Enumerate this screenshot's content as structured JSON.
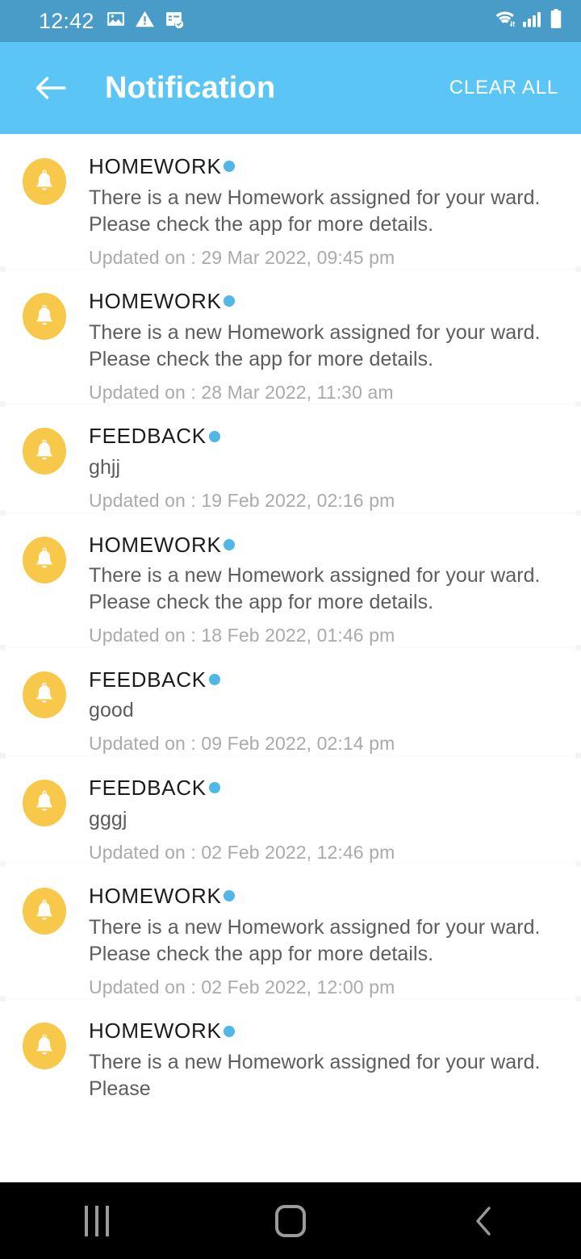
{
  "statusbar": {
    "time": "12:42",
    "left_icons": [
      "photo-icon",
      "warning-triangle-icon",
      "document-check-icon"
    ],
    "right_icons": [
      "wifi-icon",
      "cellular-signal-icon",
      "battery-icon"
    ],
    "background_color": "#4a9cc8"
  },
  "header": {
    "back_icon": "back-arrow-icon",
    "title": "Notification",
    "clear_all_label": "CLEAR ALL",
    "background_color": "#5bc6f5",
    "text_color": "#ffffff"
  },
  "theme": {
    "bell_badge_color": "#f8c84a",
    "unread_dot_color": "#4fb8e8",
    "title_color": "#1b1b1b",
    "desc_color": "#5d5d5d",
    "time_color": "#abaaaa",
    "page_background": "#ffffff",
    "navbar_background": "#000000"
  },
  "notifications": [
    {
      "icon": "bell-icon",
      "title": "HOMEWORK",
      "unread": true,
      "description": "There is a new Homework assigned for your ward. Please check the app for more details.",
      "time": "Updated on : 29 Mar 2022, 09:45 pm"
    },
    {
      "icon": "bell-icon",
      "title": "HOMEWORK",
      "unread": true,
      "description": "There is a new Homework assigned for your ward. Please check the app for more details.",
      "time": "Updated on : 28 Mar 2022, 11:30 am"
    },
    {
      "icon": "bell-icon",
      "title": "FEEDBACK",
      "unread": true,
      "description": "ghjj",
      "time": "Updated on : 19 Feb 2022, 02:16 pm"
    },
    {
      "icon": "bell-icon",
      "title": "HOMEWORK",
      "unread": true,
      "description": "There is a new Homework assigned for your ward. Please check the app for more details.",
      "time": "Updated on : 18 Feb 2022, 01:46 pm"
    },
    {
      "icon": "bell-icon",
      "title": "FEEDBACK",
      "unread": true,
      "description": "good",
      "time": "Updated on : 09 Feb 2022, 02:14 pm"
    },
    {
      "icon": "bell-icon",
      "title": "FEEDBACK",
      "unread": true,
      "description": "gggj",
      "time": "Updated on : 02 Feb 2022, 12:46 pm"
    },
    {
      "icon": "bell-icon",
      "title": "HOMEWORK",
      "unread": true,
      "description": "There is a new Homework assigned for your ward. Please check the app for more details.",
      "time": "Updated on : 02 Feb 2022, 12:00 pm"
    },
    {
      "icon": "bell-icon",
      "title": "HOMEWORK",
      "unread": true,
      "description": "There is a new Homework assigned for your ward. Please",
      "time": ""
    }
  ],
  "navbar": {
    "recents_label": "recents-icon",
    "home_label": "home-icon",
    "back_label": "back-icon"
  }
}
